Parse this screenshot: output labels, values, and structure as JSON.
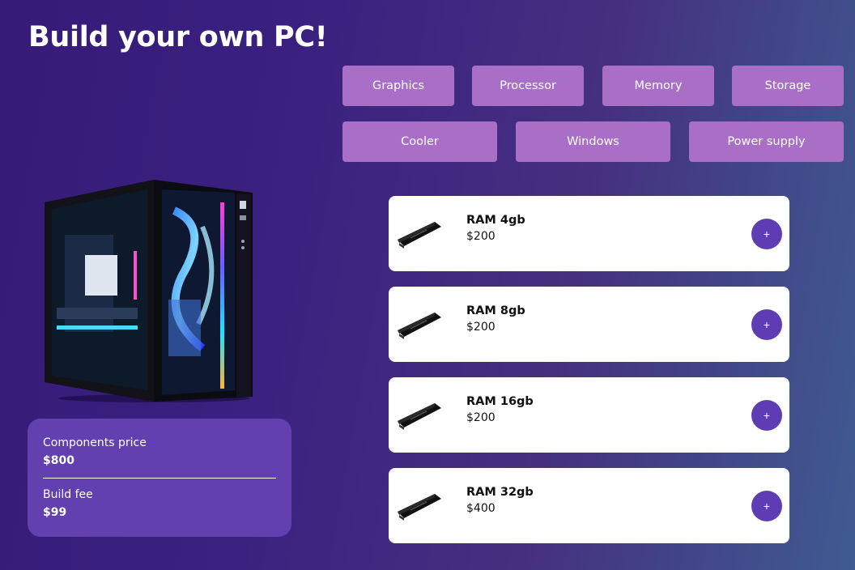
{
  "page": {
    "title": "Build your own PC!"
  },
  "categories": [
    {
      "label": "Graphics"
    },
    {
      "label": "Processor"
    },
    {
      "label": "Memory"
    },
    {
      "label": "Storage"
    },
    {
      "label": "Cooler"
    },
    {
      "label": "Windows"
    },
    {
      "label": "Power supply"
    }
  ],
  "summary": {
    "components_label": "Components price",
    "components_value": "$800",
    "fee_label": "Build fee",
    "fee_value": "$99"
  },
  "products": [
    {
      "name": "RAM 4gb",
      "price": "$200",
      "add_label": "+"
    },
    {
      "name": "RAM 8gb",
      "price": "$200",
      "add_label": "+"
    },
    {
      "name": "RAM 16gb",
      "price": "$200",
      "add_label": "+"
    },
    {
      "name": "RAM 32gb",
      "price": "$400",
      "add_label": "+"
    }
  ],
  "colors": {
    "category_button": "#a96fc6",
    "summary_panel": "#6240b0",
    "add_button": "#5e3db4"
  },
  "icons": {
    "pc": "pc-case-image",
    "ram": "ram-stick-icon"
  }
}
